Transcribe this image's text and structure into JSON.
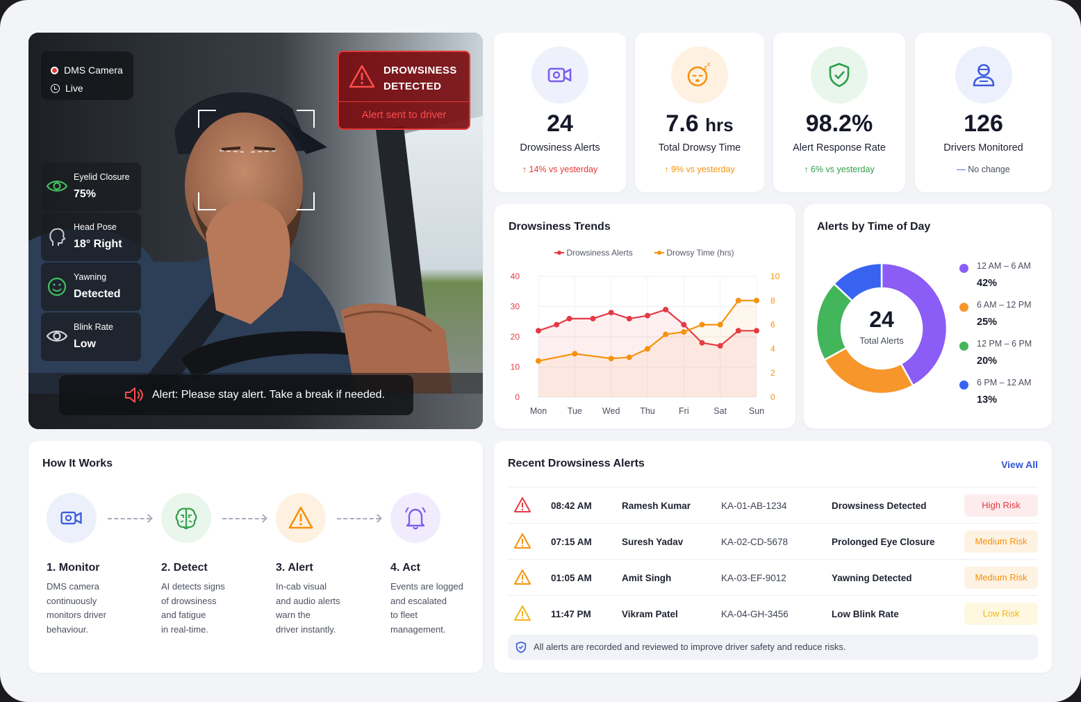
{
  "camera": {
    "source_label": "DMS Camera",
    "status_label": "Live",
    "alert_title_line1": "DROWSINESS",
    "alert_title_line2": "DETECTED",
    "alert_sub": "Alert sent to driver",
    "metrics": [
      {
        "label": "Eyelid Closure",
        "value": "75%",
        "icon": "eye-icon"
      },
      {
        "label": "Head Pose",
        "value": "18° Right",
        "icon": "head-icon"
      },
      {
        "label": "Yawning",
        "value": "Detected",
        "icon": "smiley-icon"
      },
      {
        "label": "Blink Rate",
        "value": "Low",
        "icon": "eye-icon"
      }
    ],
    "banner": "Alert: Please stay alert. Take a break if needed."
  },
  "stats": [
    {
      "value": "24",
      "unit": "",
      "label": "Drowsiness Alerts",
      "change": "14% vs yesterday",
      "trend": "up",
      "color": "#e53935",
      "icon": "video-camera-icon"
    },
    {
      "value": "7.6",
      "unit": "hrs",
      "label": "Total Drowsy Time",
      "change": "9% vs yesterday",
      "trend": "up",
      "color": "#f5920b",
      "icon": "sleepy-face-icon"
    },
    {
      "value": "98.2%",
      "unit": "",
      "label": "Alert Response Rate",
      "change": "6% vs yesterday",
      "trend": "up",
      "color": "#2e9d48",
      "icon": "shield-check-icon"
    },
    {
      "value": "126",
      "unit": "",
      "label": "Drivers Monitored",
      "change": "No change",
      "trend": "flat",
      "color": "#3b5bdb",
      "icon": "driver-icon"
    }
  ],
  "trends": {
    "title": "Drowsiness Trends",
    "chart_data": {
      "type": "line",
      "x": [
        "Mon",
        "Tue",
        "Wed",
        "Thu",
        "Fri",
        "Sat",
        "Sun"
      ],
      "series": [
        {
          "name": "Drowsiness Alerts",
          "color": "#e53945",
          "axis": "left",
          "x": [
            0,
            0.5,
            0.85,
            1.5,
            2.0,
            2.5,
            3.0,
            3.5,
            4.0,
            4.5,
            5.0,
            5.5,
            6.0
          ],
          "values": [
            22,
            24,
            26,
            26,
            28,
            26,
            27,
            29,
            24,
            18,
            17,
            22,
            22
          ]
        },
        {
          "name": "Drowsy Time (hrs)",
          "color": "#f5920b",
          "axis": "right",
          "x": [
            0,
            1.0,
            2.0,
            2.5,
            3.0,
            3.5,
            4.0,
            4.5,
            5.0,
            5.5,
            6.0
          ],
          "values": [
            3.0,
            3.6,
            3.2,
            3.3,
            4.0,
            5.2,
            5.4,
            6.0,
            6.0,
            8.0,
            8.0
          ]
        }
      ],
      "left_axis": {
        "ticks": [
          "0",
          "10",
          "20",
          "30",
          "40"
        ],
        "range": [
          0,
          40
        ]
      },
      "right_axis": {
        "ticks": [
          "0",
          "2",
          "4",
          "6",
          "8",
          "10"
        ],
        "range": [
          0,
          10
        ]
      },
      "grid": true,
      "legend": "top-center"
    }
  },
  "timeofday": {
    "title": "Alerts by Time of Day",
    "center_value": "24",
    "center_label": "Total Alerts",
    "chart_data": {
      "type": "pie",
      "categories": [
        "12 AM – 6 AM",
        "6 AM – 12 PM",
        "12 PM – 6 PM",
        "6 PM – 12 AM"
      ],
      "values": [
        42,
        25,
        20,
        13
      ],
      "labels": [
        "42%",
        "25%",
        "20%",
        "13%"
      ],
      "colors": [
        "#8b5cf6",
        "#f7962a",
        "#43b55a",
        "#3763f0"
      ]
    }
  },
  "how": {
    "title": "How It Works",
    "steps": [
      {
        "title": "1. Monitor",
        "lines": [
          "DMS camera",
          "continuously",
          "monitors driver",
          "behaviour."
        ],
        "icon": "video-camera-icon"
      },
      {
        "title": "2. Detect",
        "lines": [
          "AI detects signs",
          "of drowsiness",
          "and fatigue",
          "in real-time."
        ],
        "icon": "brain-icon"
      },
      {
        "title": "3. Alert",
        "lines": [
          "In-cab visual",
          "and audio alerts",
          "warn the",
          "driver instantly."
        ],
        "icon": "warning-icon"
      },
      {
        "title": "4. Act",
        "lines": [
          "Events are logged",
          "and escalated",
          "to fleet",
          "management."
        ],
        "icon": "bell-icon"
      }
    ]
  },
  "recent": {
    "title": "Recent Drowsiness Alerts",
    "view_all": "View All",
    "rows": [
      {
        "time": "08:42 AM",
        "driver": "Ramesh Kumar",
        "vehicle": "KA-01-AB-1234",
        "event": "Drowsiness Detected",
        "risk": "High Risk",
        "color": "#e53945",
        "bg": "#fdecee"
      },
      {
        "time": "07:15 AM",
        "driver": "Suresh Yadav",
        "vehicle": "KA-02-CD-5678",
        "event": "Prolonged Eye Closure",
        "risk": "Medium Risk",
        "color": "#f5920b",
        "bg": "#fef2e3"
      },
      {
        "time": "01:05 AM",
        "driver": "Amit Singh",
        "vehicle": "KA-03-EF-9012",
        "event": "Yawning Detected",
        "risk": "Medium Risk",
        "color": "#f5920b",
        "bg": "#fef2e3"
      },
      {
        "time": "11:47 PM",
        "driver": "Vikram Patel",
        "vehicle": "KA-04-GH-3456",
        "event": "Low Blink Rate",
        "risk": "Low Risk",
        "color": "#f2b41c",
        "bg": "#fef8e1"
      }
    ],
    "note": "All alerts are recorded and reviewed to improve driver safety and reduce risks."
  }
}
